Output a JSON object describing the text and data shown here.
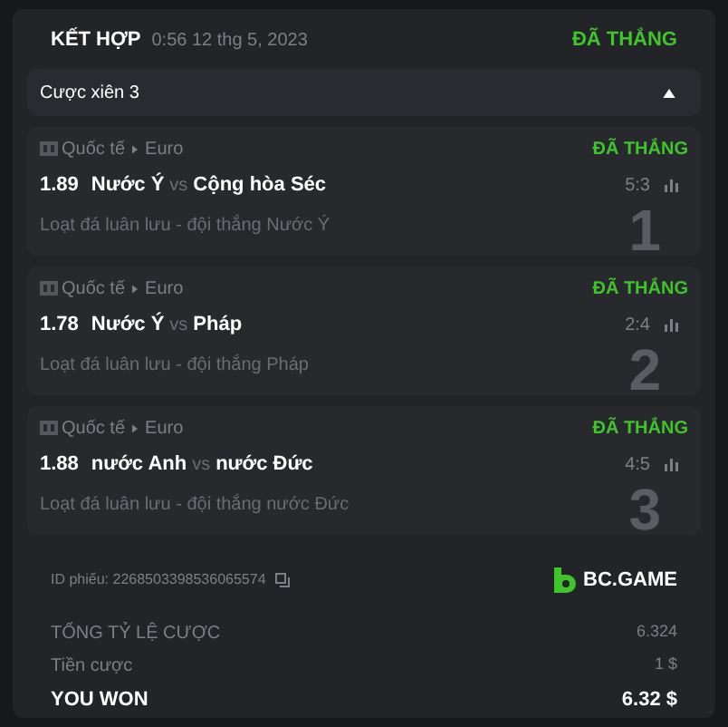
{
  "header": {
    "title": "KẾT HỢP",
    "time": "0:56 12 thg 5, 2023",
    "status": "ĐÃ THẮNG"
  },
  "parlay": {
    "label": "Cược xiên 3",
    "expanded": true
  },
  "legs": [
    {
      "category": "Quốc tế",
      "league": "Euro",
      "status": "ĐÃ THẮNG",
      "odds": "1.89",
      "home": "Nước Ý",
      "vs": "vs",
      "away": "Cộng hòa Séc",
      "score": "5:3",
      "market": "Loạt đá luân lưu - đội thắng Nước Ý",
      "number": "1"
    },
    {
      "category": "Quốc tế",
      "league": "Euro",
      "status": "ĐÃ THẮNG",
      "odds": "1.78",
      "home": "Nước Ý",
      "vs": "vs",
      "away": "Pháp",
      "score": "2:4",
      "market": "Loạt đá luân lưu - đội thắng Pháp",
      "number": "2"
    },
    {
      "category": "Quốc tế",
      "league": "Euro",
      "status": "ĐÃ THẮNG",
      "odds": "1.88",
      "home": "nước Anh",
      "vs": "vs",
      "away": "nước Đức",
      "score": "4:5",
      "market": "Loạt đá luân lưu - đội thắng nước Đức",
      "number": "3"
    }
  ],
  "ticket": {
    "id": "ID phiếu: 2268503398536065574",
    "brand": "BC.GAME"
  },
  "summary": [
    {
      "kind": "normal",
      "label": "TỔNG TỶ LỆ CƯỢC",
      "value": "6.324"
    },
    {
      "kind": "normal",
      "label": "Tiền cược",
      "value": "1 $"
    },
    {
      "kind": "total",
      "label": "YOU WON",
      "value": "6.32 $"
    }
  ]
}
